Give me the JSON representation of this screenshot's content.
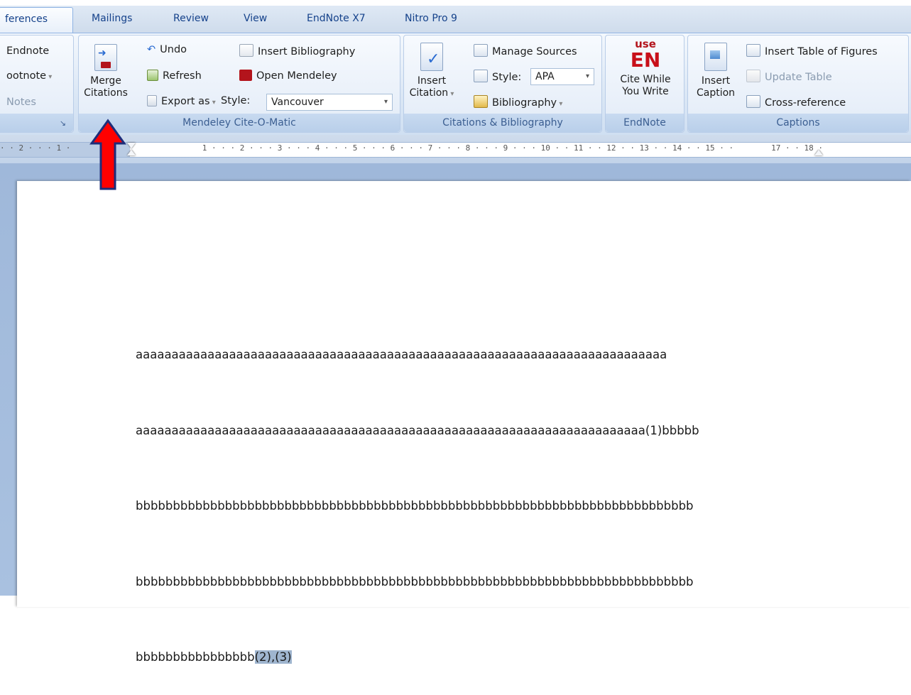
{
  "ribbon_tabs": [
    "ferences",
    "Mailings",
    "Review",
    "View",
    "EndNote X7",
    "Nitro Pro 9"
  ],
  "footnotes_group": {
    "endnote": "Endnote",
    "footnote": "ootnote",
    "notes": "Notes"
  },
  "mendeley": {
    "merge_line1": "Merge",
    "merge_line2": "Citations",
    "undo": "Undo",
    "refresh": "Refresh",
    "export": "Export as",
    "insert_bibliography": "Insert Bibliography",
    "open_mendeley": "Open Mendeley",
    "style_label": "Style:",
    "style_value": "Vancouver",
    "group_label": "Mendeley Cite-O-Matic"
  },
  "citations": {
    "insert_line1": "Insert",
    "insert_line2": "Citation",
    "manage_sources": "Manage Sources",
    "style_label": "Style:",
    "style_value": "APA",
    "bibliography": "Bibliography",
    "group_label": "Citations & Bibliography"
  },
  "endnote": {
    "use": "use",
    "en": "EN",
    "cite_line1": "Cite While",
    "cite_line2": "You Write",
    "group_label": "EndNote"
  },
  "captions": {
    "insert_line1": "Insert",
    "insert_line2": "Caption",
    "table_of_figures": "Insert Table of Figures",
    "update_table": "Update Table",
    "cross_reference": "Cross-reference",
    "group_label": "Captions"
  },
  "ruler_text": "· · 2 · · · 1 ·                            1 · · · 2 · · · 3 · · · 4 · · · 5 · · · 6 · · · 7 · · · 8 · · · 9 · · · 10 · · 11 · · 12 · · 13 · · 14 · · 15 · ·        17 · · 18 ·",
  "document": {
    "line1": "aaaaaaaaaaaaaaaaaaaaaaaaaaaaaaaaaaaaaaaaaaaaaaaaaaaaaaaaaaaaaaaaaaaaaaaaaa",
    "line2": "aaaaaaaaaaaaaaaaaaaaaaaaaaaaaaaaaaaaaaaaaaaaaaaaaaaaaaaaaaaaaaaaaaaaaaa(1)bbbbb",
    "line3": "bbbbbbbbbbbbbbbbbbbbbbbbbbbbbbbbbbbbbbbbbbbbbbbbbbbbbbbbbbbbbbbbbbbbbbbbbbb",
    "line4": "bbbbbbbbbbbbbbbbbbbbbbbbbbbbbbbbbbbbbbbbbbbbbbbbbbbbbbbbbbbbbbbbbbbbbbbbbbb",
    "line5_plain": "bbbbbbbbbbbbbbbb",
    "line5_selected": "(2),(3)"
  },
  "colors": {
    "annotation_arrow": "#ff0000",
    "arrow_outline": "#1d2d7a",
    "ribbon_text": "#15428b"
  }
}
